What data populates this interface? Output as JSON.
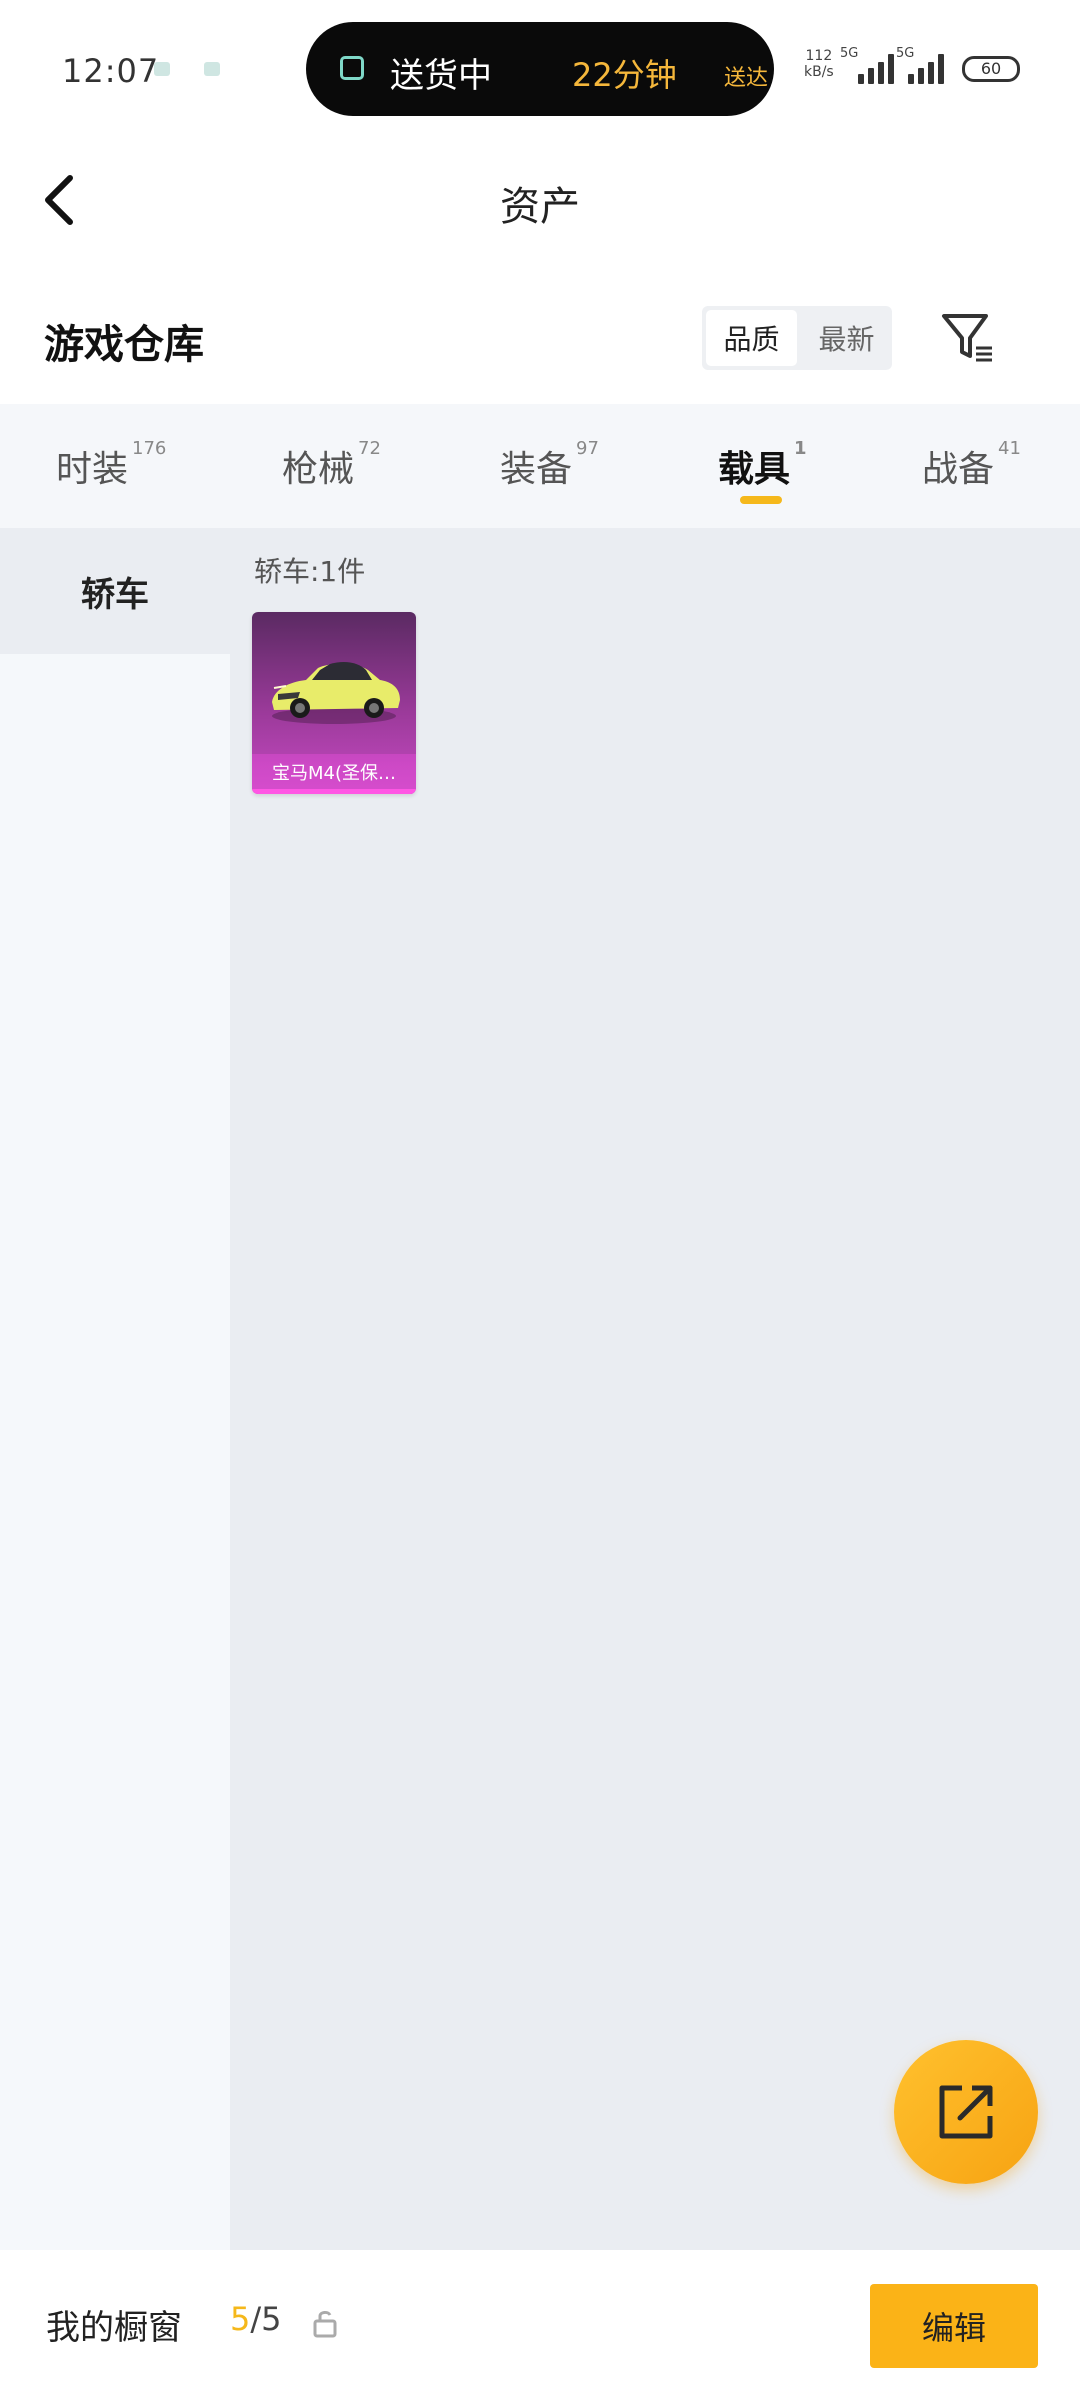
{
  "status_bar": {
    "time": "12:07",
    "pill_text": "送货中",
    "pill_eta": "22分钟",
    "pill_suffix": "送达",
    "speed_value": "112",
    "speed_unit": "kB/s",
    "net1": "5G",
    "net2": "5G",
    "battery": "60"
  },
  "header": {
    "title": "资产",
    "back_icon": "chevron-left-icon"
  },
  "section": {
    "title": "游戏仓库",
    "sort_options": [
      "品质",
      "最新"
    ],
    "filter_icon": "filter-icon"
  },
  "tabs": [
    {
      "label": "时装",
      "count": "176"
    },
    {
      "label": "枪械",
      "count": "72"
    },
    {
      "label": "装备",
      "count": "97"
    },
    {
      "label": "载具",
      "count": "1"
    },
    {
      "label": "战备",
      "count": "41"
    }
  ],
  "active_tab": "载具",
  "sidebar": {
    "items": [
      "轿车"
    ]
  },
  "grid": {
    "heading": "轿车:1件",
    "items": [
      {
        "name": "宝马M4(圣保…"
      }
    ]
  },
  "fab_icon": "external-link-icon",
  "bottom_bar": {
    "label": "我的橱窗",
    "count_current": "5",
    "count_total": "/5",
    "edit_label": "编辑",
    "lock_icon": "unlock-icon"
  },
  "colors": {
    "accent": "#f5b81b",
    "card_purple": "#c64ac2",
    "background": "#eaedf2"
  }
}
